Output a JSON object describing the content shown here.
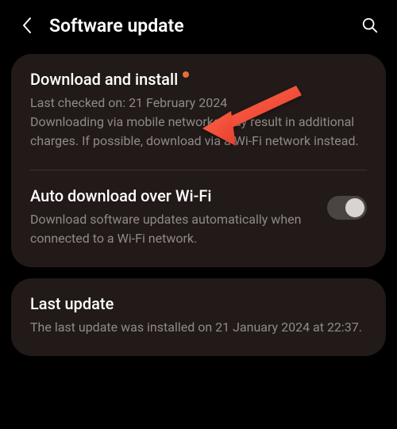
{
  "header": {
    "title": "Software update"
  },
  "download": {
    "title": "Download and install",
    "last_checked_label": "Last checked on: 21 February 2024",
    "warning": "Downloading via mobile networks may result in additional charges. If possible, download via a Wi-Fi network instead."
  },
  "auto_download": {
    "title": "Auto download over Wi-Fi",
    "desc": "Download software updates automatically when connected to a Wi-Fi network.",
    "enabled": true
  },
  "last_update": {
    "title": "Last update",
    "desc": "The last update was installed on 21 January 2024 at 22:37."
  },
  "colors": {
    "accent_dot": "#e66e33",
    "card_bg": "#221a18",
    "text_secondary": "#8f8a87"
  }
}
